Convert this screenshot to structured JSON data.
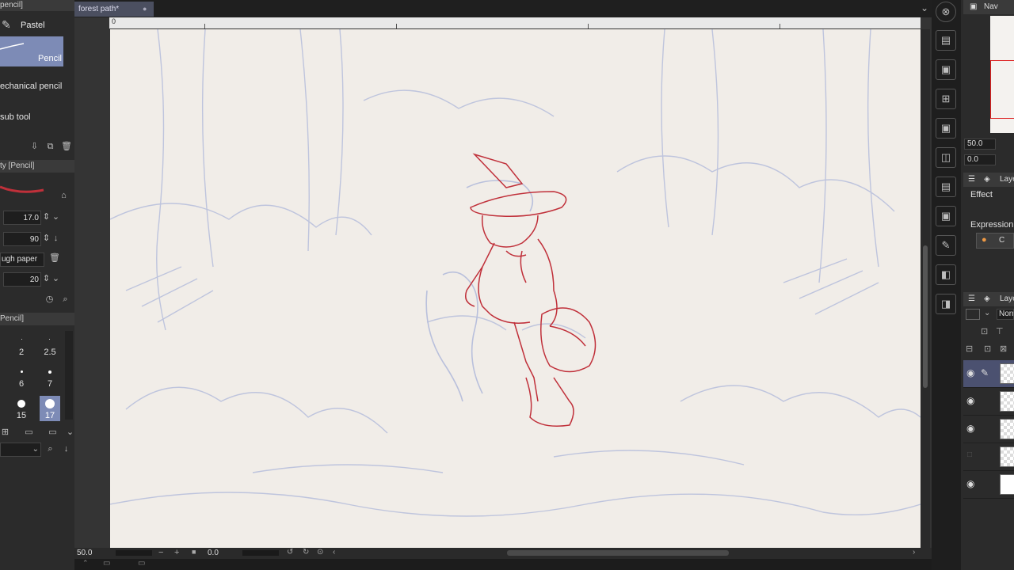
{
  "left_panel": {
    "header_label": "pencil]",
    "brush_group": "Pastel",
    "subtools": [
      {
        "label": "Pencil"
      },
      {
        "label": "echanical pencil"
      },
      {
        "label": "sub tool"
      }
    ],
    "property_header": "ty [Pencil]",
    "properties": [
      {
        "value": "17.0"
      },
      {
        "value": "90"
      },
      {
        "label": "ugh paper"
      },
      {
        "value": "20"
      }
    ],
    "size_header": "Pencil]",
    "brush_sizes": [
      "2",
      "2.5",
      "6",
      "7",
      "15",
      "17"
    ]
  },
  "document": {
    "tab_title": "forest path*",
    "ruler_origin": "0",
    "zoom": "50.0",
    "rotation": "0.0"
  },
  "navigator": {
    "header": "Nav",
    "zoom": "50.0",
    "angle": "0.0"
  },
  "layer_property": {
    "header": "Laye",
    "effect_label": "Effect",
    "expression_label": "Expression",
    "color_button": "C"
  },
  "layers_panel": {
    "header": "Laye",
    "blend_mode": "Norn",
    "layers": [
      {
        "visible": true,
        "active": true
      },
      {
        "visible": true,
        "active": false
      },
      {
        "visible": true,
        "active": false
      },
      {
        "visible": false,
        "active": false
      },
      {
        "visible": true,
        "active": false
      }
    ]
  },
  "colors": {
    "accent_tab": "#4b4f60",
    "selected_subtool": "#7d8bb6",
    "sketch_red": "#c0303a",
    "sketch_blue": "#b9c0dc",
    "paper": "#f1ede8"
  }
}
